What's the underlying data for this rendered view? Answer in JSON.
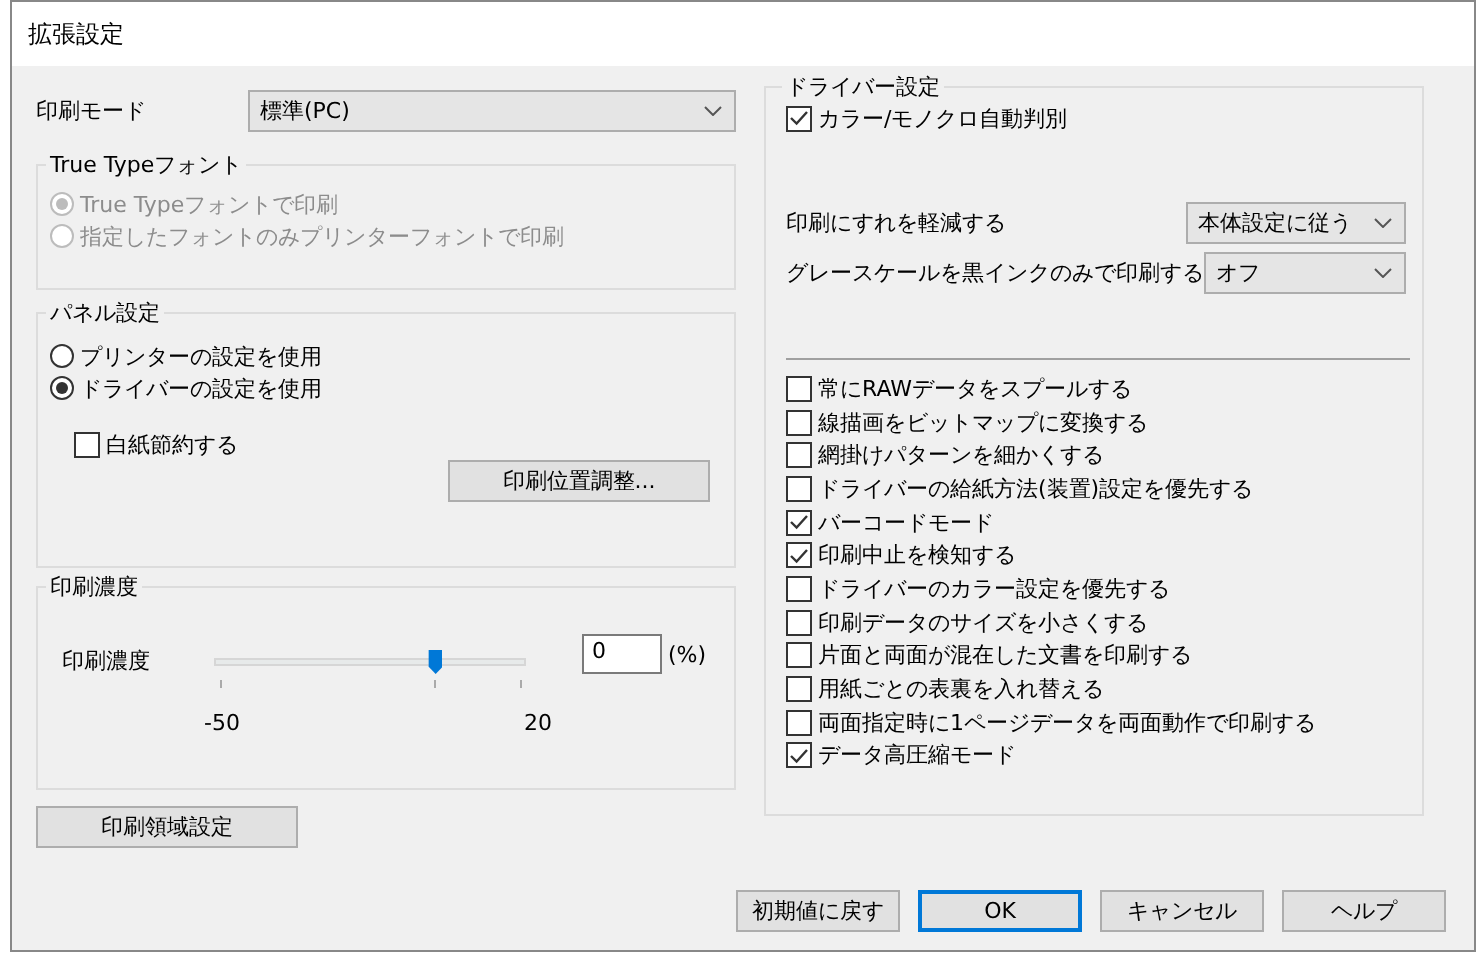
{
  "window": {
    "title": "拡張設定"
  },
  "print_mode": {
    "label": "印刷モード",
    "value": "標準(PC)"
  },
  "truetype_group": {
    "title": "True Typeフォント",
    "disabled": true,
    "options": [
      {
        "label": "True Typeフォントで印刷",
        "selected": true
      },
      {
        "label": "指定したフォントのみプリンターフォントで印刷",
        "selected": false
      }
    ]
  },
  "panel_group": {
    "title": "パネル設定",
    "options": [
      {
        "label": "プリンターの設定を使用",
        "selected": false
      },
      {
        "label": "ドライバーの設定を使用",
        "selected": true
      }
    ],
    "blank_saving": {
      "label": "白紙節約する",
      "checked": false
    },
    "button": "印刷位置調整..."
  },
  "density_group": {
    "title": "印刷濃度",
    "label": "印刷濃度",
    "level": 0.71,
    "min_label": "-50",
    "max_label": "20",
    "value": "0",
    "unit": "(%)"
  },
  "area_button": "印刷領域設定",
  "driver_group": {
    "title": "ドライバー設定",
    "auto_color": {
      "label": "カラー/モノクロ自動判別",
      "checked": true
    },
    "selects": [
      {
        "label": "印刷にすれを軽減する",
        "value": "本体設定に従う"
      },
      {
        "label": "グレースケールを黒インクのみで印刷する",
        "value": "オフ"
      }
    ],
    "options": [
      {
        "label": "常にRAWデータをスプールする",
        "checked": false
      },
      {
        "label": "線描画をビットマップに変換する",
        "checked": false
      },
      {
        "label": "網掛けパターンを細かくする",
        "checked": false
      },
      {
        "label": "ドライバーの給紙方法(装置)設定を優先する",
        "checked": false
      },
      {
        "label": "バーコードモード",
        "checked": true
      },
      {
        "label": "印刷中止を検知する",
        "checked": true
      },
      {
        "label": "ドライバーのカラー設定を優先する",
        "checked": false
      },
      {
        "label": "印刷データのサイズを小さくする",
        "checked": false
      },
      {
        "label": "片面と両面が混在した文書を印刷する",
        "checked": false
      },
      {
        "label": "用紙ごとの表裏を入れ替える",
        "checked": false
      },
      {
        "label": "両面指定時に1ページデータを両面動作で印刷する",
        "checked": false
      },
      {
        "label": "データ高圧縮モード",
        "checked": true
      }
    ]
  },
  "buttons": [
    {
      "label": "初期値に戻す",
      "default": false
    },
    {
      "label": "OK",
      "default": true
    },
    {
      "label": "キャンセル",
      "default": false
    },
    {
      "label": "ヘルプ",
      "default": false
    }
  ]
}
